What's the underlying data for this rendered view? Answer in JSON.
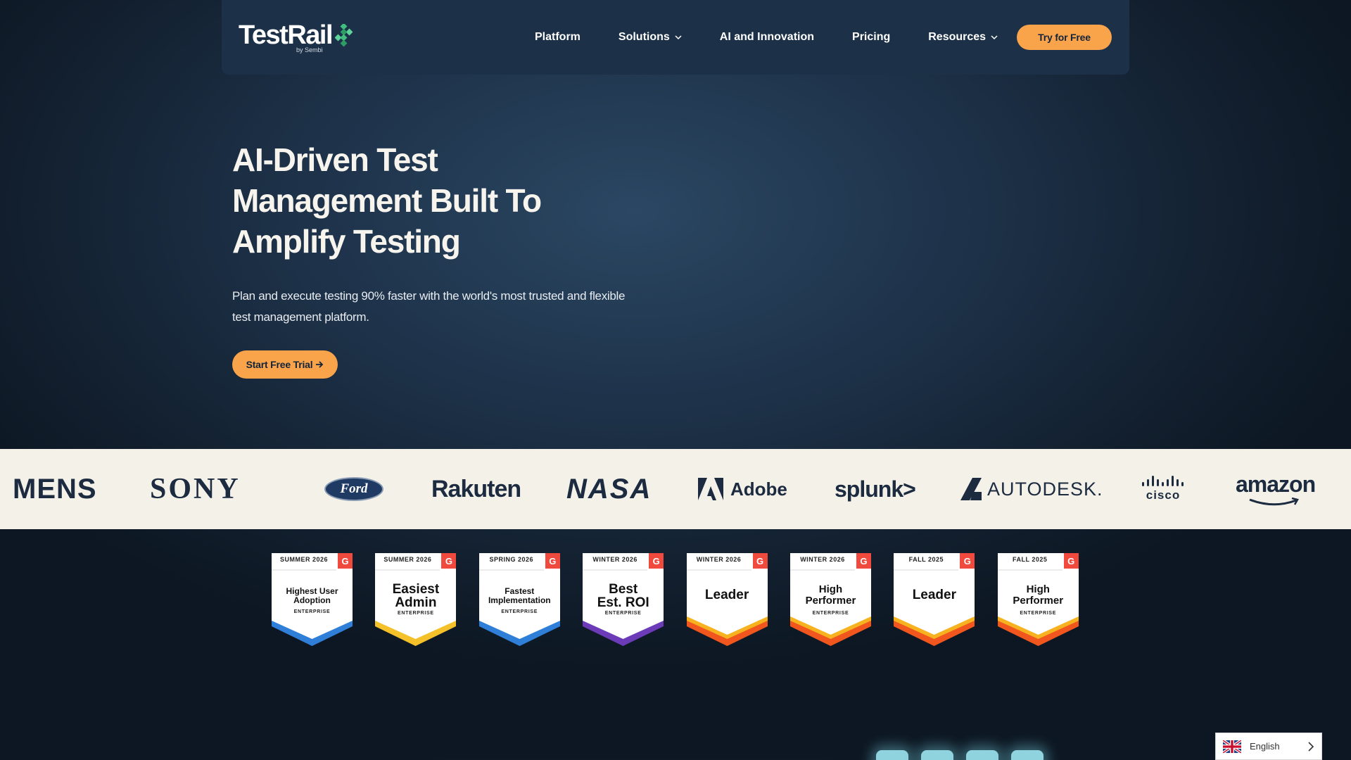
{
  "nav": {
    "logo_text": "TestRail",
    "logo_sub": "by Sembi",
    "links": [
      {
        "label": "Platform",
        "has_dropdown": false
      },
      {
        "label": "Solutions",
        "has_dropdown": true
      },
      {
        "label": "AI and Innovation",
        "has_dropdown": false
      },
      {
        "label": "Pricing",
        "has_dropdown": false
      },
      {
        "label": "Resources",
        "has_dropdown": true
      }
    ],
    "cta_label": "Try for Free"
  },
  "hero": {
    "title_lines": [
      "AI-Driven Test",
      "Management Built To",
      "Amplify Testing"
    ],
    "subtitle": "Plan and execute testing 90% faster with the world's most trusted and flexible test management platform.",
    "cta_label": "Start Free Trial",
    "cta_icon": "arrow-right-icon"
  },
  "customer_logos": [
    "MENS",
    "SONY",
    "Ford",
    "Rakuten",
    "NASA",
    "Adobe",
    "splunk>",
    "AUTODESK.",
    "cisco",
    "amazon"
  ],
  "badges": [
    {
      "season": "SUMMER 2026",
      "title_lines": [
        "Highest User",
        "Adoption"
      ],
      "subtitle": "ENTERPRISE",
      "accent": "#2f7fd8"
    },
    {
      "season": "SUMMER 2026",
      "title_lines": [
        "Easiest",
        "Admin"
      ],
      "subtitle": "ENTERPRISE",
      "accent": "#f4c12b"
    },
    {
      "season": "SPRING 2026",
      "title_lines": [
        "Fastest",
        "Implementation"
      ],
      "subtitle": "ENTERPRISE",
      "accent": "#2f7fd8"
    },
    {
      "season": "WINTER 2026",
      "title_lines": [
        "Best",
        "Est. ROI"
      ],
      "subtitle": "ENTERPRISE",
      "accent": "#6b3bb8"
    },
    {
      "season": "WINTER 2026",
      "title_lines": [
        "Leader"
      ],
      "subtitle": "",
      "accent": "#f0561d"
    },
    {
      "season": "WINTER 2026",
      "title_lines": [
        "High",
        "Performer"
      ],
      "subtitle": "ENTERPRISE",
      "accent": "#f0561d"
    },
    {
      "season": "FALL 2025",
      "title_lines": [
        "Leader"
      ],
      "subtitle": "",
      "accent": "#f0561d"
    },
    {
      "season": "FALL 2025",
      "title_lines": [
        "High",
        "Performer"
      ],
      "subtitle": "ENTERPRISE",
      "accent": "#f0561d"
    }
  ],
  "badge_logo": "G",
  "language": {
    "label": "English",
    "flag_icon": "uk-flag-icon"
  },
  "colors": {
    "accent_orange": "#f9a34b",
    "nav_bg": "#1c3047",
    "strip_bg": "#f4f1e9"
  }
}
